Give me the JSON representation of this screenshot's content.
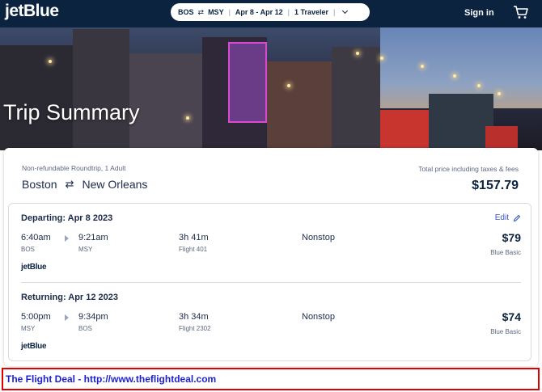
{
  "header": {
    "logo": "jetBlue",
    "search": {
      "origin": "BOS",
      "swap_symbol": "⇄",
      "destination": "MSY",
      "dates": "Apr 8 - Apr 12",
      "travelers": "1 Traveler"
    },
    "sign_in": "Sign in",
    "cart_icon": "cart-icon"
  },
  "hero": {
    "title": "Trip Summary"
  },
  "summary": {
    "trip_type": "Non-refundable Roundtrip, 1 Adult",
    "origin_city": "Boston",
    "swap_symbol": "⇄",
    "destination_city": "New Orleans",
    "total_label": "Total price including taxes & fees",
    "total_price": "$157.79"
  },
  "segments": [
    {
      "heading": "Departing: Apr 8 2023",
      "edit_label": "Edit",
      "depart_time": "6:40am",
      "depart_airport": "BOS",
      "arrive_time": "9:21am",
      "arrive_airport": "MSY",
      "duration": "3h 41m",
      "flight": "Flight 401",
      "stops": "Nonstop",
      "price": "$79",
      "fare": "Blue Basic",
      "carrier": "jetBlue"
    },
    {
      "heading": "Returning: Apr 12 2023",
      "depart_time": "5:00pm",
      "depart_airport": "MSY",
      "arrive_time": "9:34pm",
      "arrive_airport": "BOS",
      "duration": "3h 34m",
      "flight": "Flight 2302",
      "stops": "Nonstop",
      "price": "$74",
      "fare": "Blue Basic",
      "carrier": "jetBlue"
    }
  ],
  "footer": {
    "deal_text": "The Flight Deal - http://www.theflightdeal.com"
  },
  "colors": {
    "header_bg": "#0c2340",
    "link_blue": "#3a56c4",
    "deal_border": "#e00000",
    "deal_text": "#1c1fd1"
  }
}
